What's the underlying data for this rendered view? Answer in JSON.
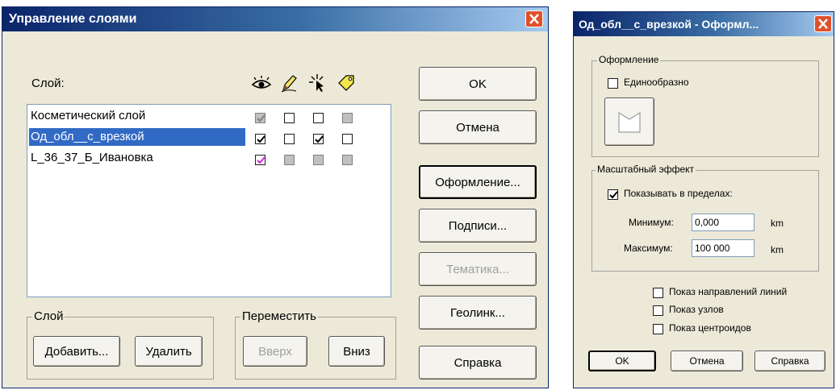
{
  "main_dialog": {
    "title": "Управление слоями",
    "list_label": "Слой:",
    "column_icons": [
      "eye-icon",
      "pencil-icon",
      "select-cursor-icon",
      "label-tag-icon"
    ],
    "layers": [
      {
        "name": "Косметический слой",
        "visible": "checked-gray",
        "editable": "empty",
        "selectable": "empty",
        "labels": "gray"
      },
      {
        "name": "Од_обл__с_врезкой",
        "visible": "checked",
        "editable": "empty",
        "selectable": "checked",
        "labels": "empty",
        "selected": true
      },
      {
        "name": "L_36_37_Б_Ивановка",
        "visible": "checked-magenta",
        "editable": "gray",
        "selectable": "gray",
        "labels": "gray"
      }
    ],
    "buttons": {
      "ok": "OK",
      "cancel": "Отмена",
      "style": "Оформление...",
      "labels": "Подписи...",
      "thematic": "Тематика...",
      "geolink": "Геолинк...",
      "help": "Справка"
    },
    "layer_group": {
      "label": "Слой",
      "add": "Добавить...",
      "remove": "Удалить"
    },
    "move_group": {
      "label": "Переместить",
      "up": "Вверх",
      "down": "Вниз"
    }
  },
  "style_dialog": {
    "title": "Од_обл__с_врезкой - Оформл...",
    "appearance_group": {
      "label": "Оформление",
      "uniform_label": "Единообразно",
      "uniform_checked": false
    },
    "zoom_group": {
      "label": "Масштабный эффект",
      "show_within_label": "Показывать в пределах:",
      "show_within_checked": true,
      "min_label": "Минимум:",
      "min_value": "0,000",
      "max_label": "Максимум:",
      "max_value": "100 000",
      "unit": "km"
    },
    "options": [
      {
        "label": "Показ направлений линий",
        "checked": false
      },
      {
        "label": "Показ узлов",
        "checked": false
      },
      {
        "label": "Показ центроидов",
        "checked": false
      }
    ],
    "buttons": {
      "ok": "OK",
      "cancel": "Отмена",
      "help": "Справка"
    }
  }
}
